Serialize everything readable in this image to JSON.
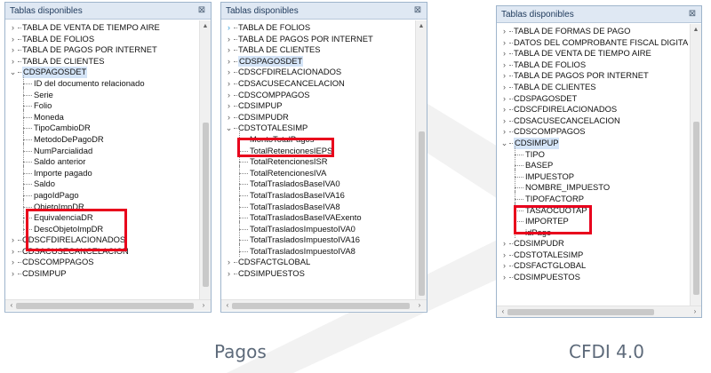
{
  "panels": [
    {
      "header": "Tablas disponibles",
      "rows": [
        {
          "label": "TABLA DE VENTA DE TIEMPO AIRE",
          "level": 0,
          "exp": "›"
        },
        {
          "label": "TABLA DE FOLIOS",
          "level": 0,
          "exp": "›"
        },
        {
          "label": "TABLA DE PAGOS POR INTERNET",
          "level": 0,
          "exp": "›"
        },
        {
          "label": "TABLA DE CLIENTES",
          "level": 0,
          "exp": "›"
        },
        {
          "label": "CDSPAGOSDET",
          "level": 0,
          "exp": "⌄",
          "selected": true
        },
        {
          "label": "ID del documento relacionado",
          "level": 1
        },
        {
          "label": "Serie",
          "level": 1
        },
        {
          "label": "Folio",
          "level": 1
        },
        {
          "label": "Moneda",
          "level": 1
        },
        {
          "label": "TipoCambioDR",
          "level": 1
        },
        {
          "label": "MetodoDePagoDR",
          "level": 1
        },
        {
          "label": "NumParcialidad",
          "level": 1
        },
        {
          "label": "Saldo anterior",
          "level": 1
        },
        {
          "label": "Importe pagado",
          "level": 1
        },
        {
          "label": "Saldo",
          "level": 1
        },
        {
          "label": "pagoIdPago",
          "level": 1
        },
        {
          "label": "ObjetoImpDR",
          "level": 1
        },
        {
          "label": "EquivalenciaDR",
          "level": 1
        },
        {
          "label": "DescObjetoImpDR",
          "level": 1
        },
        {
          "label": "CDSCFDIRELACIONADOS",
          "level": 0,
          "exp": "›"
        },
        {
          "label": "CDSACUSECANCELACION",
          "level": 0,
          "exp": "›"
        },
        {
          "label": "CDSCOMPPAGOS",
          "level": 0,
          "exp": "›"
        },
        {
          "label": "CDSIMPUP",
          "level": 0,
          "exp": "›"
        }
      ]
    },
    {
      "header": "Tablas disponibles",
      "rows": [
        {
          "label": "TABLA DE FOLIOS",
          "level": 0,
          "exp": "›",
          "exp_color": "#2f9bd8"
        },
        {
          "label": "TABLA DE PAGOS POR INTERNET",
          "level": 0,
          "exp": "›"
        },
        {
          "label": "TABLA DE CLIENTES",
          "level": 0,
          "exp": "›"
        },
        {
          "label": "CDSPAGOSDET",
          "level": 0,
          "exp": "›",
          "selected": true
        },
        {
          "label": "CDSCFDIRELACIONADOS",
          "level": 0,
          "exp": "›"
        },
        {
          "label": "CDSACUSECANCELACION",
          "level": 0,
          "exp": "›"
        },
        {
          "label": "CDSCOMPPAGOS",
          "level": 0,
          "exp": "›"
        },
        {
          "label": "CDSIMPUP",
          "level": 0,
          "exp": "›"
        },
        {
          "label": "CDSIMPUDR",
          "level": 0,
          "exp": "›"
        },
        {
          "label": "CDSTOTALESIMP",
          "level": 0,
          "exp": "⌄"
        },
        {
          "label": "MontoTotalPagos",
          "level": 1
        },
        {
          "label": "TotalRetencionesIEPS",
          "level": 1
        },
        {
          "label": "TotalRetencionesISR",
          "level": 1
        },
        {
          "label": "TotalRetencionesIVA",
          "level": 1
        },
        {
          "label": "TotalTrasladosBaseIVA0",
          "level": 1
        },
        {
          "label": "TotalTrasladosBaseIVA16",
          "level": 1
        },
        {
          "label": "TotalTrasladosBaseIVA8",
          "level": 1
        },
        {
          "label": "TotalTrasladosBaseIVAExento",
          "level": 1
        },
        {
          "label": "TotalTrasladosImpuestoIVA0",
          "level": 1
        },
        {
          "label": "TotalTrasladosImpuestoIVA16",
          "level": 1
        },
        {
          "label": "TotalTrasladosImpuestoIVA8",
          "level": 1
        },
        {
          "label": "CDSFACTGLOBAL",
          "level": 0,
          "exp": "›"
        },
        {
          "label": "CDSIMPUESTOS",
          "level": 0,
          "exp": "›"
        }
      ]
    },
    {
      "header": "Tablas disponibles",
      "rows": [
        {
          "label": "TABLA DE FORMAS DE PAGO",
          "level": 0,
          "exp": "›"
        },
        {
          "label": "DATOS DEL COMPROBANTE FISCAL DIGITA",
          "level": 0,
          "exp": "›"
        },
        {
          "label": "TABLA DE VENTA DE TIEMPO AIRE",
          "level": 0,
          "exp": "›"
        },
        {
          "label": "TABLA DE FOLIOS",
          "level": 0,
          "exp": "›"
        },
        {
          "label": "TABLA DE PAGOS POR INTERNET",
          "level": 0,
          "exp": "›"
        },
        {
          "label": "TABLA DE CLIENTES",
          "level": 0,
          "exp": "›"
        },
        {
          "label": "CDSPAGOSDET",
          "level": 0,
          "exp": "›"
        },
        {
          "label": "CDSCFDIRELACIONADOS",
          "level": 0,
          "exp": "›"
        },
        {
          "label": "CDSACUSECANCELACION",
          "level": 0,
          "exp": "›"
        },
        {
          "label": "CDSCOMPPAGOS",
          "level": 0,
          "exp": "›"
        },
        {
          "label": "CDSIMPUP",
          "level": 0,
          "exp": "⌄",
          "selected": true
        },
        {
          "label": "TIPO",
          "level": 1
        },
        {
          "label": "BASEP",
          "level": 1
        },
        {
          "label": "IMPUESTOP",
          "level": 1
        },
        {
          "label": "NOMBRE_IMPUESTO",
          "level": 1
        },
        {
          "label": "TIPOFACTORP",
          "level": 1
        },
        {
          "label": "TASAOCUOTAP",
          "level": 1
        },
        {
          "label": "IMPORTEP",
          "level": 1
        },
        {
          "label": "idPago",
          "level": 1
        },
        {
          "label": "CDSIMPUDR",
          "level": 0,
          "exp": "›"
        },
        {
          "label": "CDSTOTALESIMP",
          "level": 0,
          "exp": "›"
        },
        {
          "label": "CDSFACTGLOBAL",
          "level": 0,
          "exp": "›"
        },
        {
          "label": "CDSIMPUESTOS",
          "level": 0,
          "exp": "›"
        }
      ]
    }
  ],
  "captions": {
    "left": "Pagos",
    "right": "CFDI 4.0"
  },
  "colors": {
    "highlight": "#e8001c",
    "header_bg": "#dfe8f3",
    "selection": "#d4e4f7"
  }
}
